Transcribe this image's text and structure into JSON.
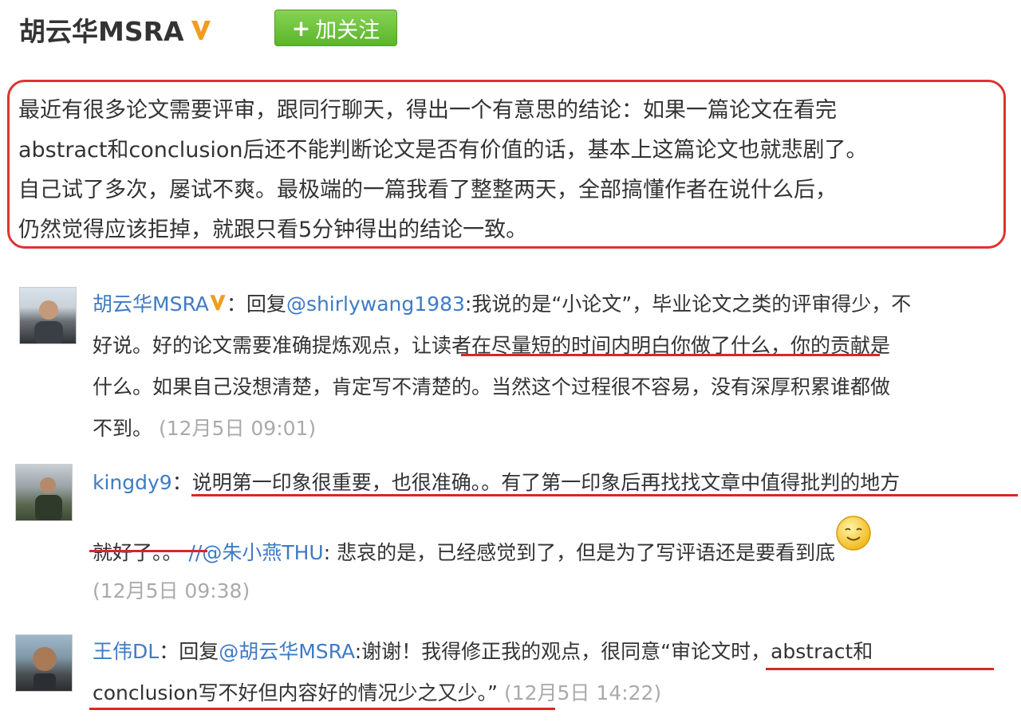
{
  "header": {
    "author": "胡云华MSRA",
    "follow_label": "加关注",
    "follow_plus": "+"
  },
  "post": {
    "lines": [
      "最近有很多论文需要评审，跟同行聊天，得出一个有意思的结论：如果一篇论文在看完",
      "abstract和conclusion后还不能判断论文是否有价值的话，基本上这篇论文也就悲剧了。",
      "自己试了多次，屡试不爽。最极端的一篇我看了整整两天，全部搞懂作者在说什么后，",
      "仍然觉得应该拒掉，就跟只看5分钟得出的结论一致。"
    ]
  },
  "comments": [
    {
      "user": "胡云华MSRA",
      "colon": "：",
      "reply_prefix": "回复",
      "mention": "@shirlywang1983",
      "text_l1": ":我说的是“小论文”，毕业论文之类的评审得少，不",
      "text_l2a": "好说。好的论文需要准确提炼观点，",
      "text_l2b": "让读者在尽量短的时间内明白你做了什么，",
      "text_l2c": "你的贡献是",
      "text_l3": "什么。如果自己没想清楚，肯定写不清楚的。当然这个过程很不容易，没有深厚积累谁都做",
      "text_l4": "不到。",
      "time": "(12月5日 09:01)"
    },
    {
      "user": "kingdy9",
      "colon": "：",
      "text_l1": "说明第一印象很重要，也很准确。。有了第一印象后再找找文章中值得批判的地方",
      "text_l2a": "就好了。。",
      "repost_mark": "//",
      "mention": "@朱小燕THU",
      "text_l2b": ": 悲哀的是，已经感觉到了，但是为了写评语还是要看到底",
      "emoji": "smiley-emoji",
      "time": "(12月5日 09:38)"
    },
    {
      "user": "王伟DL",
      "colon": "：",
      "reply_prefix": "回复",
      "mention": "@胡云华MSRA",
      "text_l1a": ":谢谢！我得修正我的观点，很同意“",
      "text_l1b": "审论文时，abstract和",
      "text_l2a": "conclusion写不好但内容好的情况少之又少。",
      "text_l2b": "”",
      "time": "(12月5日 14:22)"
    }
  ],
  "colors": {
    "link": "#3f7bc4",
    "highlight": "#d92626",
    "follow_button": "#5bb52a",
    "verified": "#f29c1f",
    "time": "#aaaaaa"
  }
}
